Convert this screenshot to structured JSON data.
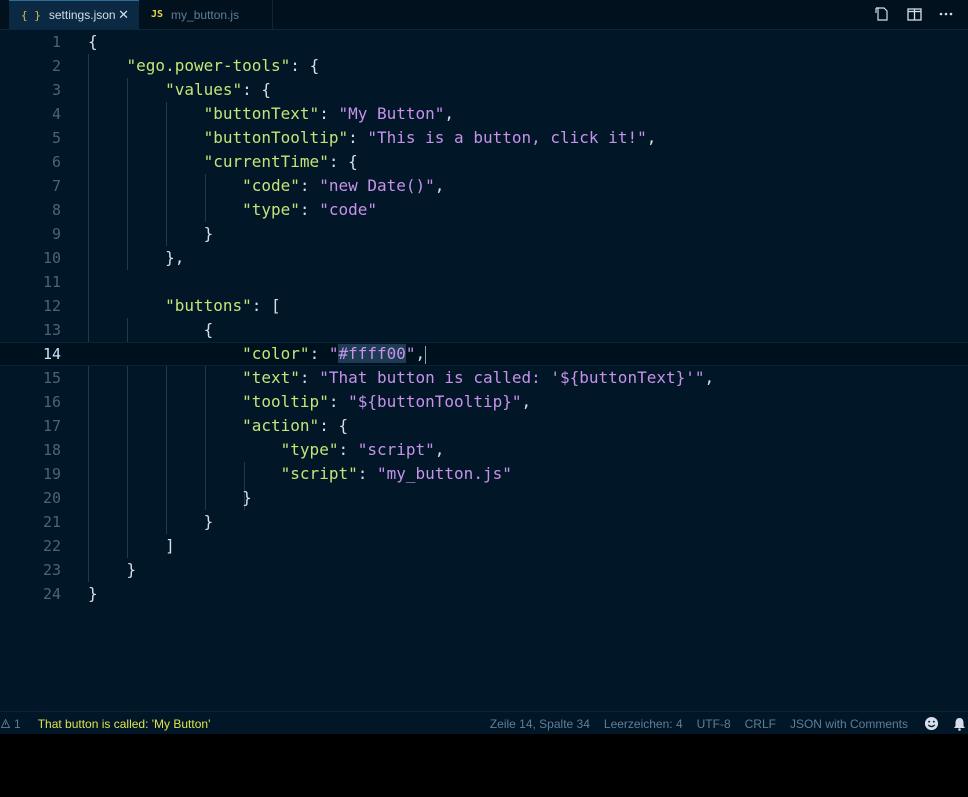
{
  "tabs": [
    {
      "icon": "{ }",
      "label": "settings.json",
      "close": "✕"
    },
    {
      "icon": "JS",
      "label": "my_button.js"
    }
  ],
  "editor": {
    "current_line": 14,
    "lines": [
      {
        "n": "1",
        "tokens": [
          {
            "t": "p",
            "v": "{"
          }
        ]
      },
      {
        "n": "2",
        "tokens": [
          {
            "t": "p",
            "v": "    "
          },
          {
            "t": "k",
            "v": "\"ego.power-tools\""
          },
          {
            "t": "p",
            "v": ": {"
          }
        ]
      },
      {
        "n": "3",
        "tokens": [
          {
            "t": "p",
            "v": "        "
          },
          {
            "t": "k",
            "v": "\"values\""
          },
          {
            "t": "p",
            "v": ": {"
          }
        ]
      },
      {
        "n": "4",
        "tokens": [
          {
            "t": "p",
            "v": "            "
          },
          {
            "t": "k",
            "v": "\"buttonText\""
          },
          {
            "t": "p",
            "v": ": "
          },
          {
            "t": "s",
            "v": "\"My Button\""
          },
          {
            "t": "p",
            "v": ","
          }
        ]
      },
      {
        "n": "5",
        "tokens": [
          {
            "t": "p",
            "v": "            "
          },
          {
            "t": "k",
            "v": "\"buttonTooltip\""
          },
          {
            "t": "p",
            "v": ": "
          },
          {
            "t": "s",
            "v": "\"This is a button, click it!\""
          },
          {
            "t": "p",
            "v": ","
          }
        ]
      },
      {
        "n": "6",
        "tokens": [
          {
            "t": "p",
            "v": "            "
          },
          {
            "t": "k",
            "v": "\"currentTime\""
          },
          {
            "t": "p",
            "v": ": {"
          }
        ]
      },
      {
        "n": "7",
        "tokens": [
          {
            "t": "p",
            "v": "                "
          },
          {
            "t": "k",
            "v": "\"code\""
          },
          {
            "t": "p",
            "v": ": "
          },
          {
            "t": "s",
            "v": "\"new Date()\""
          },
          {
            "t": "p",
            "v": ","
          }
        ]
      },
      {
        "n": "8",
        "tokens": [
          {
            "t": "p",
            "v": "                "
          },
          {
            "t": "k",
            "v": "\"type\""
          },
          {
            "t": "p",
            "v": ": "
          },
          {
            "t": "s",
            "v": "\"code\""
          }
        ]
      },
      {
        "n": "9",
        "tokens": [
          {
            "t": "p",
            "v": "            }"
          }
        ]
      },
      {
        "n": "10",
        "tokens": [
          {
            "t": "p",
            "v": "        },"
          }
        ]
      },
      {
        "n": "11",
        "tokens": []
      },
      {
        "n": "12",
        "tokens": [
          {
            "t": "p",
            "v": "        "
          },
          {
            "t": "k",
            "v": "\"buttons\""
          },
          {
            "t": "p",
            "v": ": ["
          }
        ]
      },
      {
        "n": "13",
        "tokens": [
          {
            "t": "p",
            "v": "            {"
          }
        ]
      },
      {
        "n": "14",
        "tokens": [
          {
            "t": "p",
            "v": "                "
          },
          {
            "t": "k",
            "v": "\"color\""
          },
          {
            "t": "p",
            "v": ": "
          },
          {
            "t": "s",
            "v": "\""
          },
          {
            "t": "sel",
            "v": "#ffff00"
          },
          {
            "t": "s",
            "v": "\""
          },
          {
            "t": "p",
            "v": ","
          },
          {
            "t": "caret",
            "v": ""
          }
        ]
      },
      {
        "n": "15",
        "tokens": [
          {
            "t": "p",
            "v": "                "
          },
          {
            "t": "k",
            "v": "\"text\""
          },
          {
            "t": "p",
            "v": ": "
          },
          {
            "t": "s",
            "v": "\"That button is called: '${buttonText}'\""
          },
          {
            "t": "p",
            "v": ","
          }
        ]
      },
      {
        "n": "16",
        "tokens": [
          {
            "t": "p",
            "v": "                "
          },
          {
            "t": "k",
            "v": "\"tooltip\""
          },
          {
            "t": "p",
            "v": ": "
          },
          {
            "t": "s",
            "v": "\"${buttonTooltip}\""
          },
          {
            "t": "p",
            "v": ","
          }
        ]
      },
      {
        "n": "17",
        "tokens": [
          {
            "t": "p",
            "v": "                "
          },
          {
            "t": "k",
            "v": "\"action\""
          },
          {
            "t": "p",
            "v": ": {"
          }
        ]
      },
      {
        "n": "18",
        "tokens": [
          {
            "t": "p",
            "v": "                    "
          },
          {
            "t": "k",
            "v": "\"type\""
          },
          {
            "t": "p",
            "v": ": "
          },
          {
            "t": "s",
            "v": "\"script\""
          },
          {
            "t": "p",
            "v": ","
          }
        ]
      },
      {
        "n": "19",
        "tokens": [
          {
            "t": "p",
            "v": "                    "
          },
          {
            "t": "k",
            "v": "\"script\""
          },
          {
            "t": "p",
            "v": ": "
          },
          {
            "t": "s",
            "v": "\"my_button.js\""
          }
        ]
      },
      {
        "n": "20",
        "tokens": [
          {
            "t": "p",
            "v": "                }"
          }
        ]
      },
      {
        "n": "21",
        "tokens": [
          {
            "t": "p",
            "v": "            }"
          }
        ]
      },
      {
        "n": "22",
        "tokens": [
          {
            "t": "p",
            "v": "        ]"
          }
        ]
      },
      {
        "n": "23",
        "tokens": [
          {
            "t": "p",
            "v": "    }"
          }
        ]
      },
      {
        "n": "24",
        "tokens": [
          {
            "t": "p",
            "v": "}"
          }
        ]
      }
    ]
  },
  "status": {
    "warnings_icon": "warning-icon",
    "warnings_count": "1",
    "message": "That button is called: 'My Button'",
    "position": "Zeile 14, Spalte 34",
    "indent": "Leerzeichen: 4",
    "encoding": "UTF-8",
    "eol": "CRLF",
    "language": "JSON with Comments"
  },
  "colors": {
    "background": "#011627",
    "key": "#c5e478",
    "string": "#c792ea",
    "punctuation": "#d6deeb",
    "status_message": "#e2e24e"
  }
}
